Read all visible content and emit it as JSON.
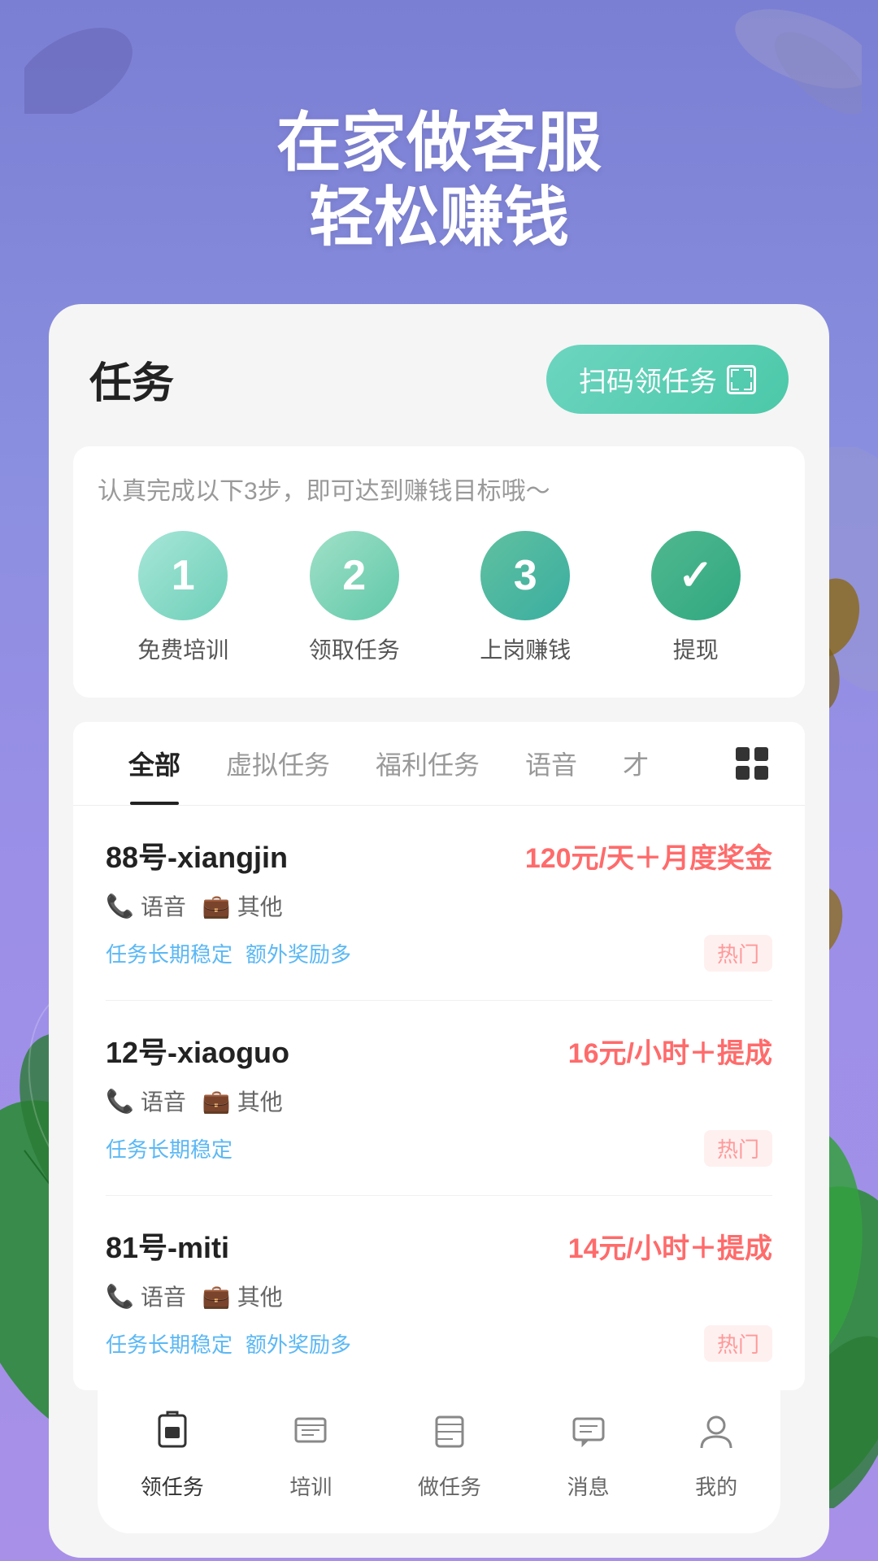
{
  "header": {
    "title_line1": "在家做客服",
    "title_line2": "轻松赚钱"
  },
  "card": {
    "title": "任务",
    "scan_btn": "扫码领任务"
  },
  "steps": {
    "hint": "认真完成以下3步，即可达到赚钱目标哦～",
    "items": [
      {
        "number": "1",
        "label": "免费培训"
      },
      {
        "number": "2",
        "label": "领取任务"
      },
      {
        "number": "3",
        "label": "上岗赚钱"
      },
      {
        "number": "✓",
        "label": "提现"
      }
    ]
  },
  "tabs": [
    {
      "label": "全部",
      "active": true
    },
    {
      "label": "虚拟任务",
      "active": false
    },
    {
      "label": "福利任务",
      "active": false
    },
    {
      "label": "语音",
      "active": false
    },
    {
      "label": "才",
      "active": false
    }
  ],
  "tasks": [
    {
      "name": "88号-xiangjin",
      "price": "120元/天＋月度奖金",
      "tags": [
        "语音",
        "其他"
      ],
      "labels": [
        "任务长期稳定",
        "额外奖励多"
      ],
      "hot": "热门"
    },
    {
      "name": "12号-xiaoguo",
      "price": "16元/小时＋提成",
      "tags": [
        "语音",
        "其他"
      ],
      "labels": [
        "任务长期稳定"
      ],
      "hot": "热门"
    },
    {
      "name": "81号-miti",
      "price": "14元/小时＋提成",
      "tags": [
        "语音",
        "其他"
      ],
      "labels": [
        "任务长期稳定",
        "额外奖励多"
      ],
      "hot": "热门"
    }
  ],
  "bottomNav": [
    {
      "icon": "📦",
      "label": "领任务",
      "active": true
    },
    {
      "icon": "📋",
      "label": "培训",
      "active": false
    },
    {
      "icon": "💼",
      "label": "做任务",
      "active": false
    },
    {
      "icon": "💬",
      "label": "消息",
      "active": false
    },
    {
      "icon": "👤",
      "label": "我的",
      "active": false
    }
  ]
}
